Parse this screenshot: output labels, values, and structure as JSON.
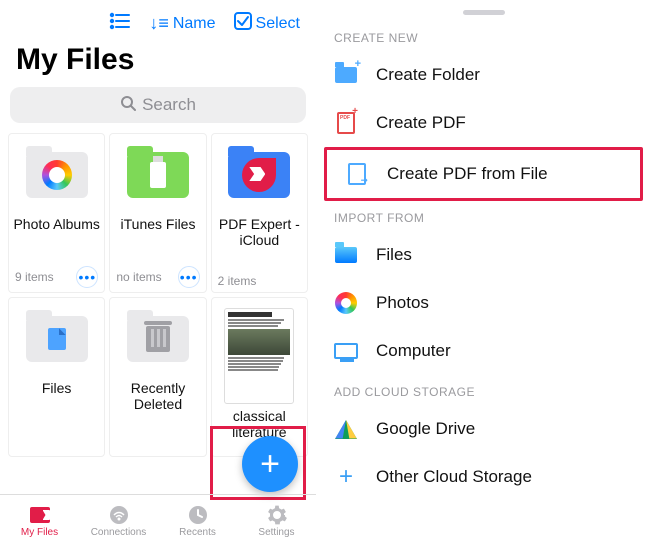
{
  "left": {
    "topbar": {
      "list_icon": "list-icon",
      "sort_label": "Name",
      "select_label": "Select"
    },
    "title": "My Files",
    "search_placeholder": "Search",
    "tiles": [
      {
        "title": "Photo Albums",
        "subtitle": "9 items",
        "has_more": true
      },
      {
        "title": "iTunes Files",
        "subtitle": "no items",
        "has_more": true
      },
      {
        "title": "PDF Expert - iCloud",
        "subtitle": "2 items",
        "has_more": false
      },
      {
        "title": "Files",
        "subtitle": "",
        "has_more": false
      },
      {
        "title": "Recently Deleted",
        "subtitle": "",
        "has_more": false
      },
      {
        "title": "classical literature",
        "subtitle": "",
        "has_more": false
      }
    ],
    "tabs": [
      {
        "label": "My Files"
      },
      {
        "label": "Connections"
      },
      {
        "label": "Recents"
      },
      {
        "label": "Settings"
      }
    ]
  },
  "right": {
    "sections": {
      "create": {
        "header": "CREATE NEW",
        "items": [
          {
            "label": "Create Folder"
          },
          {
            "label": "Create PDF"
          },
          {
            "label": "Create PDF from File"
          }
        ]
      },
      "import": {
        "header": "IMPORT FROM",
        "items": [
          {
            "label": "Files"
          },
          {
            "label": "Photos"
          },
          {
            "label": "Computer"
          }
        ]
      },
      "cloud": {
        "header": "ADD CLOUD STORAGE",
        "items": [
          {
            "label": "Google Drive"
          },
          {
            "label": "Other Cloud Storage"
          }
        ]
      }
    }
  }
}
